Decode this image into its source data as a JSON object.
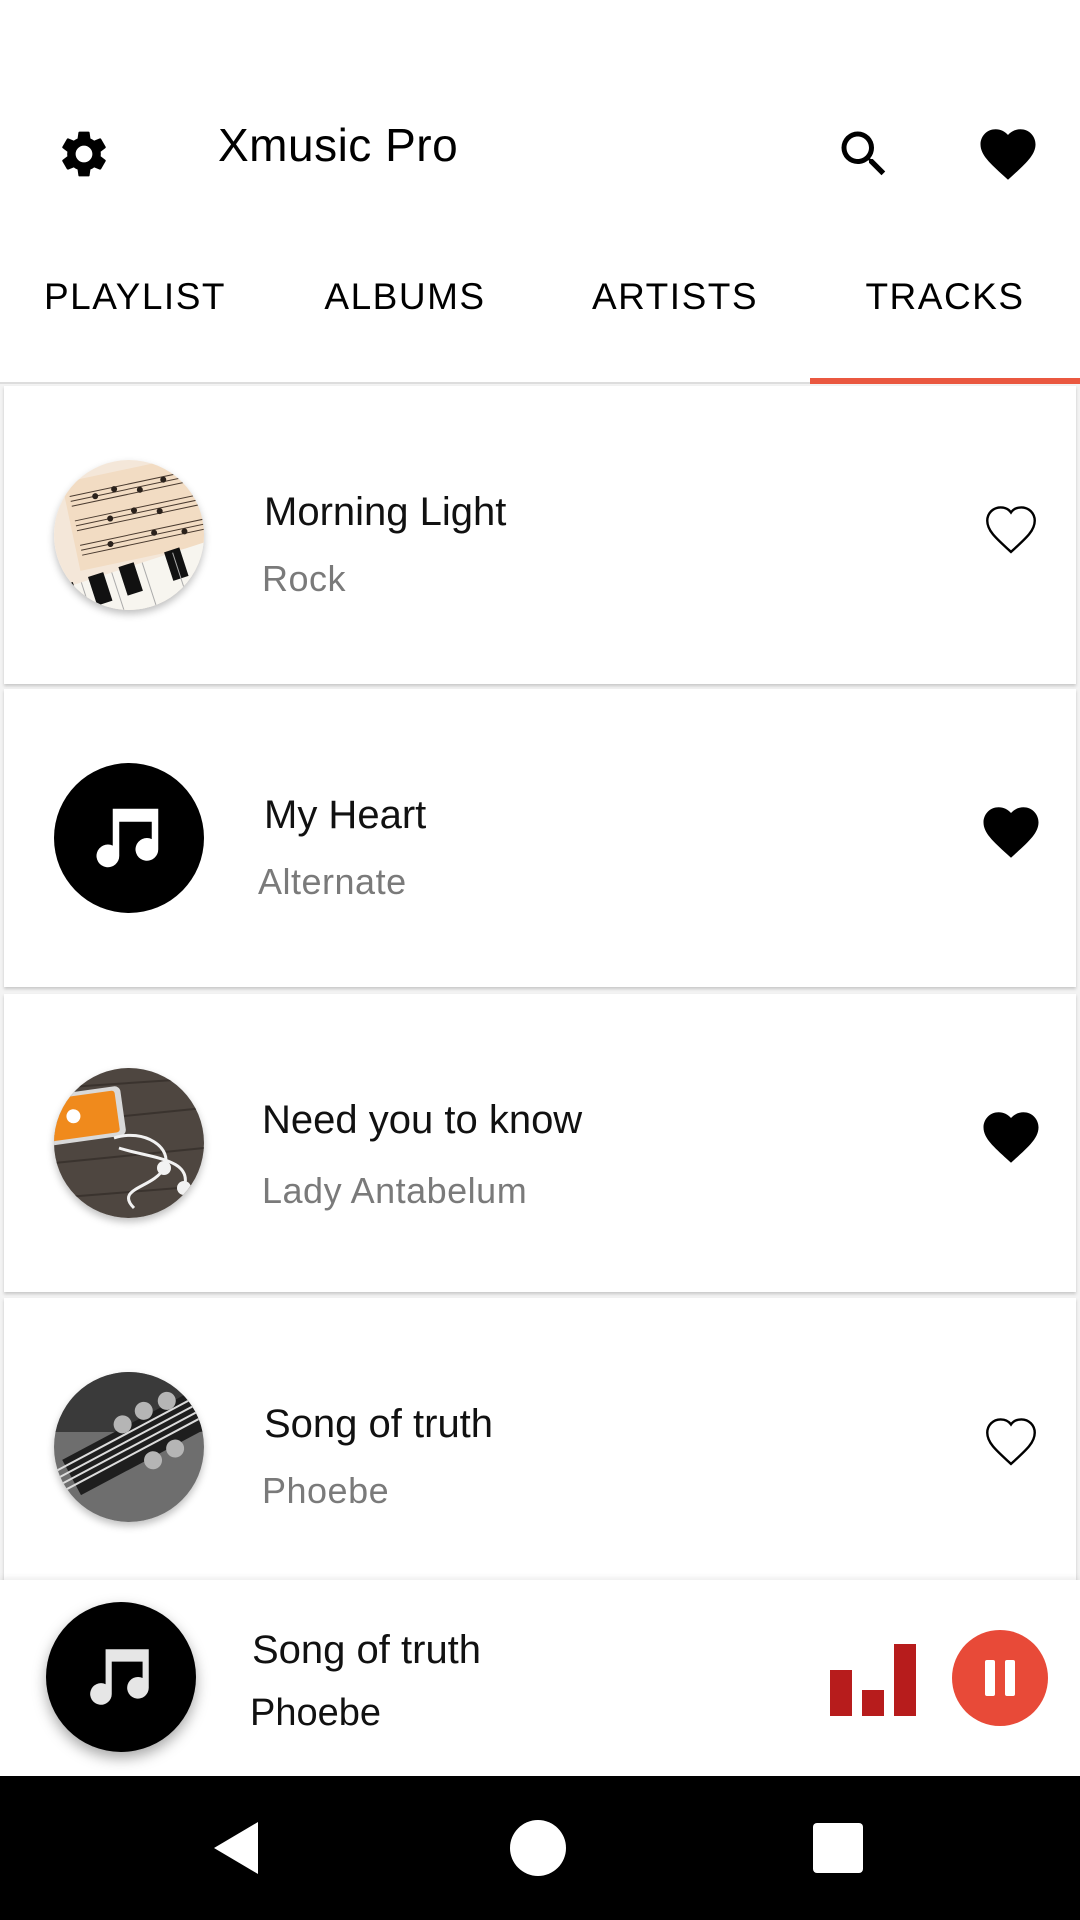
{
  "app": {
    "title": "Xmusic Pro"
  },
  "tabs": [
    {
      "label": "PLAYLIST",
      "active": false
    },
    {
      "label": "ALBUMS",
      "active": false
    },
    {
      "label": "ARTISTS",
      "active": false
    },
    {
      "label": "TRACKS",
      "active": true
    }
  ],
  "tracks": [
    {
      "title": "Morning Light",
      "subtitle": "Rock",
      "cover": "sheet-music-piano",
      "favorite": false
    },
    {
      "title": "My Heart",
      "subtitle": "Alternate",
      "cover": "music-note-icon",
      "favorite": true
    },
    {
      "title": "Need you to know",
      "subtitle": "Lady Antabelum",
      "cover": "phone-earphones",
      "favorite": true
    },
    {
      "title": "Song of truth",
      "subtitle": "Phoebe",
      "cover": "guitar-headstock",
      "favorite": false
    }
  ],
  "now_playing": {
    "title": "Song of truth",
    "subtitle": "Phoebe",
    "state": "playing"
  },
  "colors": {
    "accent": "#ea5840",
    "pause_button": "#e84a38",
    "equalizer": "#b71c1c",
    "subtitle_gray": "#7a7a7a"
  },
  "icons": [
    "settings-icon",
    "search-icon",
    "heart-icon",
    "heart-outline-icon",
    "music-note-icon",
    "equalizer-icon",
    "pause-icon",
    "back-icon",
    "home-icon",
    "recents-icon"
  ]
}
